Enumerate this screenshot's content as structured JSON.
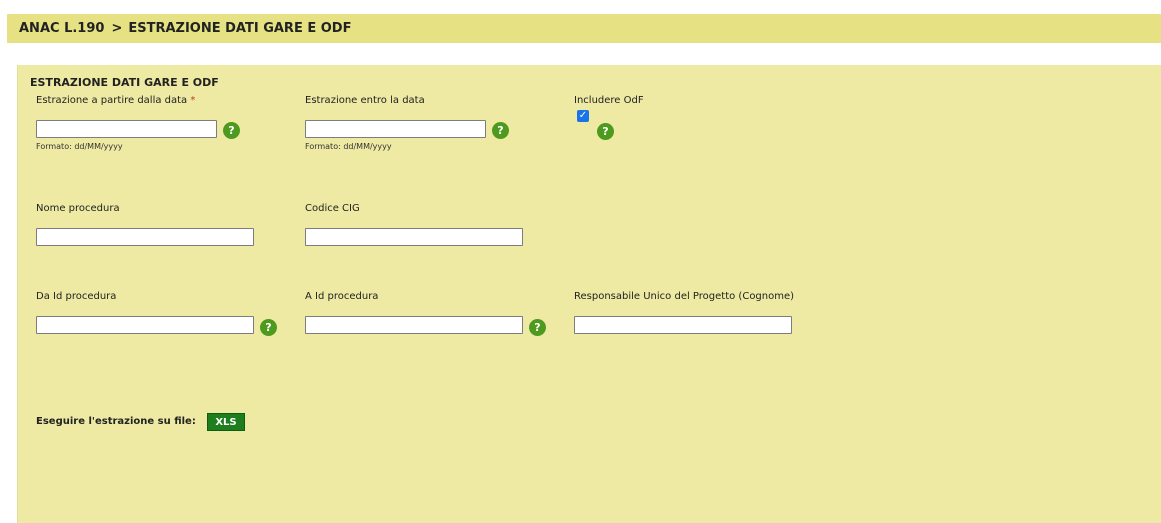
{
  "header": {
    "app": "ANAC L.190",
    "separator": ">",
    "page": "ESTRAZIONE DATI GARE E ODF"
  },
  "section": {
    "title": "ESTRAZIONE DATI GARE E ODF"
  },
  "fields": {
    "date_from": {
      "label": "Estrazione a partire dalla data",
      "required_mark": "*",
      "value": "",
      "hint": "Formato: dd/MM/yyyy"
    },
    "date_to": {
      "label": "Estrazione entro la data",
      "value": "",
      "hint": "Formato: dd/MM/yyyy"
    },
    "include_odf": {
      "label": "Includere OdF",
      "checked": true
    },
    "procedure_name": {
      "label": "Nome procedura",
      "value": ""
    },
    "cig_code": {
      "label": "Codice CIG",
      "value": ""
    },
    "id_from": {
      "label": "Da Id procedura",
      "value": ""
    },
    "id_to": {
      "label": "A Id procedura",
      "value": ""
    },
    "rup": {
      "label": "Responsabile Unico del Progetto (Cognome)",
      "value": ""
    }
  },
  "help_icon": "?",
  "export": {
    "label": "Eseguire l'estrazione su file:",
    "button": "XLS"
  },
  "colors": {
    "header_bg": "#e6e283",
    "panel_bg": "#eeeaa3",
    "help_green": "#4e9a1e",
    "xls_green": "#1e7e1e"
  }
}
